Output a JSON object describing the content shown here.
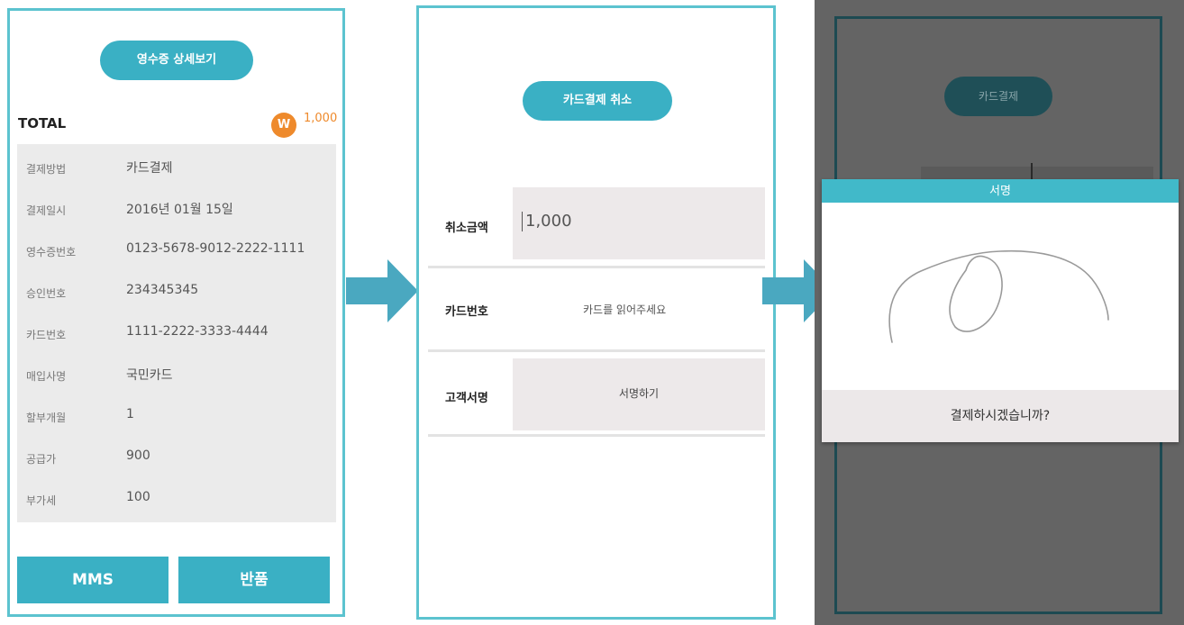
{
  "panel1": {
    "receipt_button": "영수증 상세보기",
    "total_label": "TOTAL",
    "currency_icon": "W",
    "total_amount": "1,000",
    "rows": [
      {
        "label": "결제방법",
        "value": "카드결제"
      },
      {
        "label": "결제일시",
        "value": "2016년 01월 15일"
      },
      {
        "label": "영수증번호",
        "value": "0123-5678-9012-2222-1111"
      },
      {
        "label": "승인번호",
        "value": "234345345"
      },
      {
        "label": "카드번호",
        "value": "1111-2222-3333-4444"
      },
      {
        "label": "매입사명",
        "value": "국민카드"
      },
      {
        "label": "할부개월",
        "value": "1"
      },
      {
        "label": "공급가",
        "value": "900"
      },
      {
        "label": "부가세",
        "value": "100"
      }
    ],
    "mms_button": "MMS",
    "return_button": "반품"
  },
  "panel2": {
    "cancel_button": "카드결제 취소",
    "amount_label": "취소금액",
    "amount_value": "1,000",
    "card_label": "카드번호",
    "card_hint": "카드를 읽어주세요",
    "sign_label": "고객서명",
    "sign_button": "서명하기"
  },
  "panel3": {
    "background_button": "카드결제",
    "dialog_title": "서명",
    "confirm_text": "결제하시겠습니까?"
  },
  "colors": {
    "accent": "#3ab0c4",
    "panel_border": "#5cc3cf",
    "orange": "#ee8a2c",
    "arrow": "#4aa8c0",
    "overlay": "#646464"
  }
}
